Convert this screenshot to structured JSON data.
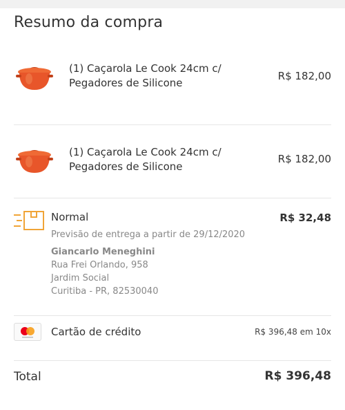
{
  "summary": {
    "title": "Resumo da compra"
  },
  "items": [
    {
      "name_line1": "(1) Caçarola Le Cook 24cm c/",
      "name_line2": "Pegadores de Silicone",
      "price": "R$ 182,00",
      "icon": "casserole-pot-icon"
    },
    {
      "name_line1": "(1) Caçarola Le Cook 24cm c/",
      "name_line2": "Pegadores de Silicone",
      "price": "R$ 182,00",
      "icon": "casserole-pot-icon"
    }
  ],
  "shipping": {
    "icon": "delivery-box-icon",
    "type": "Normal",
    "price": "R$ 32,48",
    "forecast": "Previsão de entrega a partir de 29/12/2020",
    "recipient": "Giancarlo Meneghini",
    "street": "Rua Frei Orlando, 958",
    "neighborhood": "Jardim Social",
    "city": "Curitiba - PR, 82530040"
  },
  "payment": {
    "icon": "mastercard-icon",
    "method": "Cartão de crédito",
    "installments": "R$ 396,48 em 10x"
  },
  "total": {
    "label": "Total",
    "value": "R$ 396,48"
  },
  "colors": {
    "pot_orange": "#e8562a",
    "shipping_icon": "#f0a437",
    "mastercard_red": "#eb001b",
    "mastercard_yellow": "#f79e1b"
  }
}
